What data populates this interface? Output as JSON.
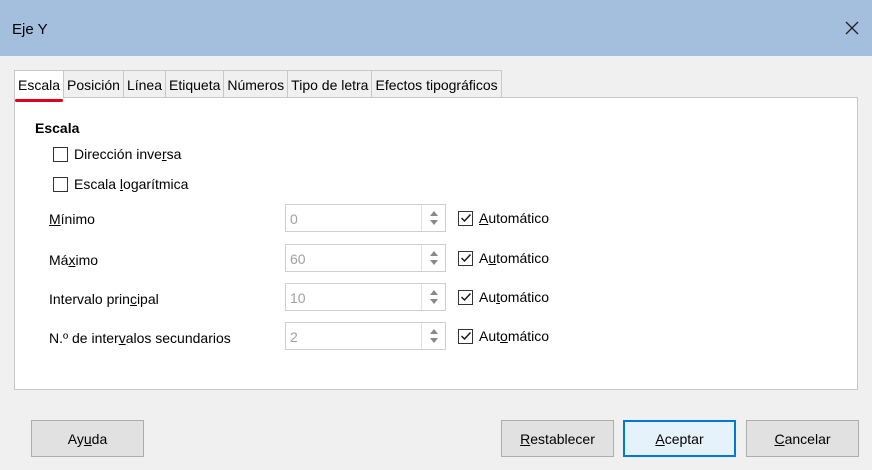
{
  "window": {
    "title": "Eje Y",
    "close_icon": "close-icon"
  },
  "tabs": [
    {
      "label": "Escala",
      "active": true
    },
    {
      "label": "Posición",
      "active": false
    },
    {
      "label": "Línea",
      "active": false
    },
    {
      "label": "Etiqueta",
      "active": false
    },
    {
      "label": "Números",
      "active": false
    },
    {
      "label": "Tipo de letra",
      "active": false
    },
    {
      "label": "Efectos tipográficos",
      "active": false
    }
  ],
  "scale": {
    "section_title": "Escala",
    "reverse_direction": {
      "label_a": "Dirección inve",
      "label_u": "r",
      "label_b": "sa",
      "checked": false
    },
    "log_scale": {
      "label_a": "Escala ",
      "label_u": "l",
      "label_b": "ogarítmica",
      "checked": false
    },
    "fields": [
      {
        "label_a": "",
        "label_u": "M",
        "label_b": "ínimo",
        "value": "0",
        "auto_a": "",
        "auto_u": "A",
        "auto_b": "utomático",
        "auto_checked": true
      },
      {
        "label_a": "Má",
        "label_u": "x",
        "label_b": "imo",
        "value": "60",
        "auto_a": "A",
        "auto_u": "u",
        "auto_b": "tomático",
        "auto_checked": true
      },
      {
        "label_a": "Intervalo prin",
        "label_u": "c",
        "label_b": "ipal",
        "value": "10",
        "auto_a": "Au",
        "auto_u": "t",
        "auto_b": "omático",
        "auto_checked": true
      },
      {
        "label_a": "N.º de inter",
        "label_u": "v",
        "label_b": "alos secundarios",
        "value": "2",
        "auto_a": "Aut",
        "auto_u": "o",
        "auto_b": "mático",
        "auto_checked": true
      }
    ]
  },
  "buttons": {
    "help_a": "Ay",
    "help_u": "u",
    "help_b": "da",
    "reset_a": "",
    "reset_u": "R",
    "reset_b": "establecer",
    "ok_a": "",
    "ok_u": "A",
    "ok_b": "ceptar",
    "cancel_a": "",
    "cancel_u": "C",
    "cancel_b": "ancelar"
  },
  "colors": {
    "titlebar": "#a4bfde",
    "active_tab_underline": "#e0001b",
    "primary_button_border": "#0078d7"
  }
}
